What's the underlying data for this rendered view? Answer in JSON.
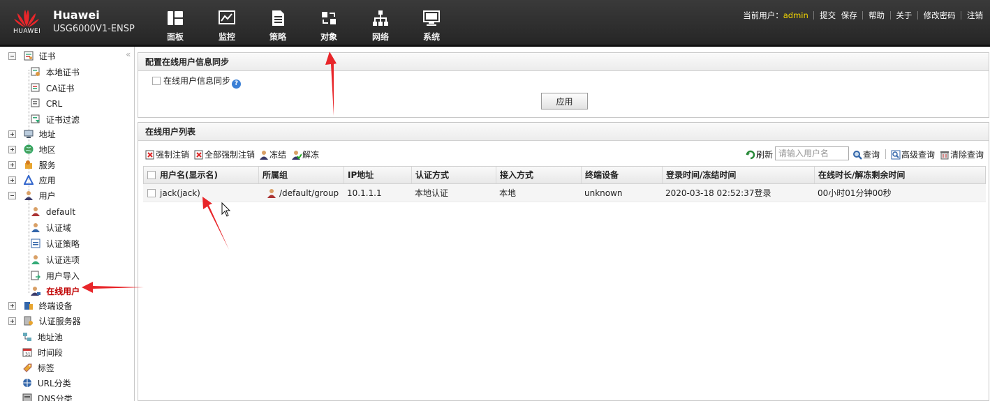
{
  "brand": {
    "logo_text": "HUAWEI",
    "name": "Huawei",
    "model": "USG6000V1-ENSP"
  },
  "nav": [
    {
      "label": "面板",
      "icon": "dashboard-icon"
    },
    {
      "label": "监控",
      "icon": "monitor-icon"
    },
    {
      "label": "策略",
      "icon": "policy-icon"
    },
    {
      "label": "对象",
      "icon": "object-icon",
      "active": true
    },
    {
      "label": "网络",
      "icon": "network-icon"
    },
    {
      "label": "系统",
      "icon": "system-icon"
    }
  ],
  "userbar": {
    "current_user_label": "当前用户：",
    "user": "admin",
    "submit": "提交",
    "save": "保存",
    "help": "帮助",
    "about": "关于",
    "change_password": "修改密码",
    "logout": "注销"
  },
  "sidebar": {
    "items": [
      {
        "label": "证书",
        "level": 0,
        "toggle": "minus"
      },
      {
        "label": "本地证书",
        "level": 1
      },
      {
        "label": "CA证书",
        "level": 1
      },
      {
        "label": "CRL",
        "level": 1
      },
      {
        "label": "证书过滤",
        "level": 1
      },
      {
        "label": "地址",
        "level": 0,
        "toggle": "plus"
      },
      {
        "label": "地区",
        "level": 0,
        "toggle": "plus"
      },
      {
        "label": "服务",
        "level": 0,
        "toggle": "plus"
      },
      {
        "label": "应用",
        "level": 0,
        "toggle": "plus"
      },
      {
        "label": "用户",
        "level": 0,
        "toggle": "minus"
      },
      {
        "label": "default",
        "level": 1
      },
      {
        "label": "认证域",
        "level": 1
      },
      {
        "label": "认证策略",
        "level": 1
      },
      {
        "label": "认证选项",
        "level": 1
      },
      {
        "label": "用户导入",
        "level": 1
      },
      {
        "label": "在线用户",
        "level": 1,
        "selected": true
      },
      {
        "label": "终端设备",
        "level": 0,
        "toggle": "plus"
      },
      {
        "label": "认证服务器",
        "level": 0,
        "toggle": "plus"
      },
      {
        "label": "地址池",
        "level": 0
      },
      {
        "label": "时间段",
        "level": 0
      },
      {
        "label": "标签",
        "level": 0
      },
      {
        "label": "URL分类",
        "level": 0
      },
      {
        "label": "DNS分类",
        "level": 0
      }
    ]
  },
  "sync_panel": {
    "title": "配置在线用户信息同步",
    "checkbox_label": "在线用户信息同步",
    "help": "?",
    "apply_label": "应用"
  },
  "list_panel": {
    "title": "在线用户列表",
    "toolbar": {
      "force_logout": "强制注销",
      "force_logout_all": "全部强制注销",
      "freeze": "冻结",
      "unfreeze": "解冻",
      "refresh": "刷新",
      "search_placeholder": "请输入用户名",
      "query": "查询",
      "advanced_query": "高级查询",
      "clear_query": "清除查询"
    },
    "columns": [
      "用户名(显示名)",
      "所属组",
      "IP地址",
      "认证方式",
      "接入方式",
      "终端设备",
      "登录时间/冻结时间",
      "在线时长/解冻剩余时间"
    ],
    "rows": [
      {
        "username": "jack(jack)",
        "group": "/default/group",
        "ip": "10.1.1.1",
        "auth": "本地认证",
        "access": "本地",
        "device": "unknown",
        "login_time": "2020-03-18 02:52:37登录",
        "duration": "00小时01分钟00秒"
      }
    ]
  },
  "colors": {
    "accent_red": "#e8262a",
    "selected_text": "#c00000",
    "topbar": "#2e2e2e",
    "admin": "#f5d700"
  }
}
